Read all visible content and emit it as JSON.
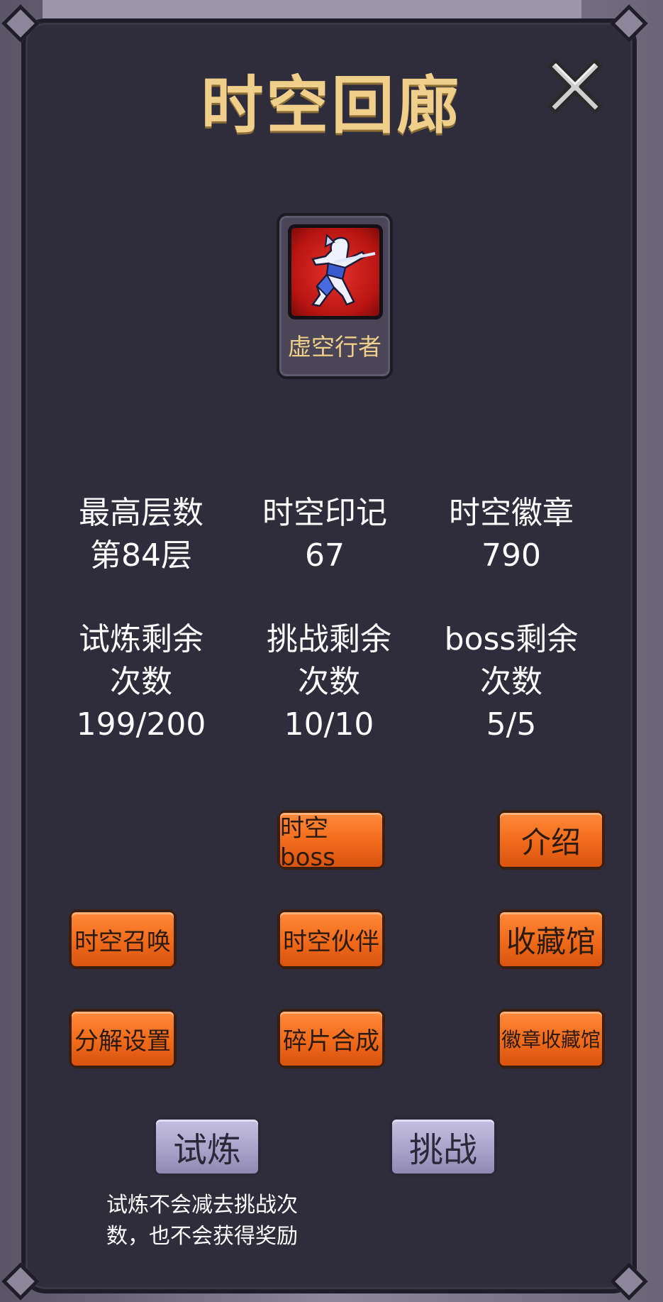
{
  "title": "时空回廊",
  "close_icon": "close-x-icon",
  "hero": {
    "name": "虚空行者"
  },
  "stats": {
    "max_floor": {
      "label": "最高层数",
      "value": "第84层"
    },
    "seal": {
      "label": "时空印记",
      "value": "67"
    },
    "badge": {
      "label": "时空徽章",
      "value": "790"
    },
    "trial_left": {
      "label1": "试炼剩余",
      "label2": "次数",
      "value": "199/200"
    },
    "challenge_left": {
      "label1": "挑战剩余",
      "label2": "次数",
      "value": "10/10"
    },
    "boss_left": {
      "label1": "boss剩余",
      "label2": "次数",
      "value": "5/5"
    }
  },
  "buttons": {
    "boss": "时空boss",
    "intro": "介绍",
    "summon": "时空召唤",
    "partner": "时空伙伴",
    "collection": "收藏馆",
    "decompose": "分解设置",
    "fragment": "碎片合成",
    "badge_collection": "徽章收藏馆",
    "trial": "试炼",
    "challenge": "挑战"
  },
  "note": "试炼不会减去挑战次数，也不会获得奖励",
  "colors": {
    "accent_gold": "#f0cf8a",
    "button_orange": "#f06a1a",
    "button_purple": "#a7a0c8",
    "panel_bg": "#2f2c3b"
  }
}
